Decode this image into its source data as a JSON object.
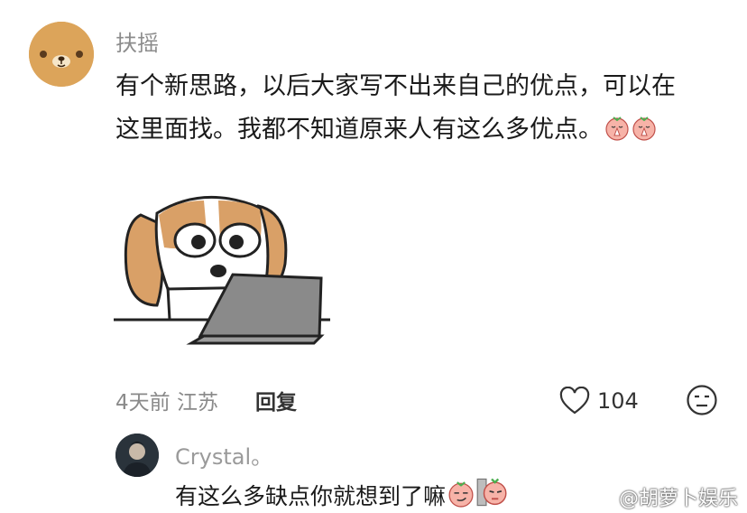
{
  "comment": {
    "username": "扶摇",
    "text_line1": "有个新思路，以后大家写不出来自己的优点，可以在",
    "text_line2": "这里面找。我都不知道原来人有这么多优点。",
    "inline_emojis": [
      "pray-emoji",
      "pray-emoji"
    ],
    "meta": "4天前 江苏",
    "reply_label": "回复",
    "like_count": "104"
  },
  "reply": {
    "username": "Crystal。",
    "text": "有这么多缺点你就想到了嘛"
  },
  "watermark": "@胡萝卜娱乐",
  "colors": {
    "avatar_bg": "#DCA45A",
    "username": "#8c8c8c",
    "text": "#1a1a1a"
  }
}
